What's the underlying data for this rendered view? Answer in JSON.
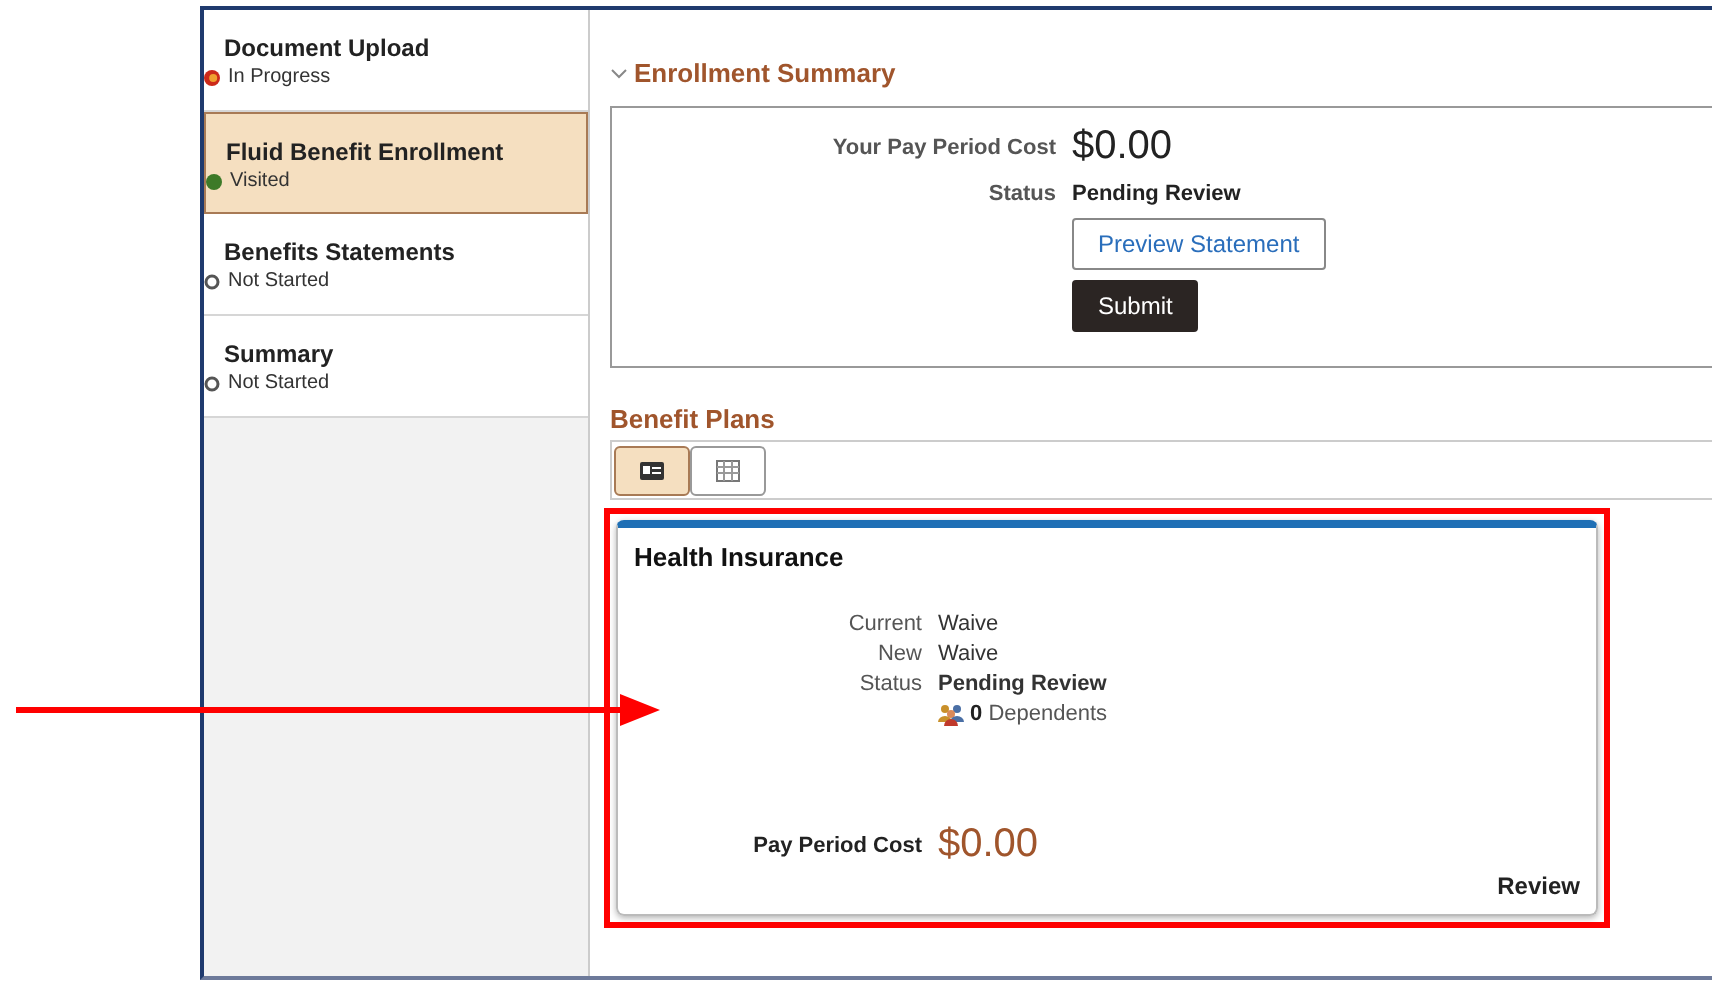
{
  "sidebar": {
    "items": [
      {
        "title": "Document Upload",
        "status": "In Progress",
        "kind": "in_progress",
        "selected": false
      },
      {
        "title": "Fluid Benefit Enrollment",
        "status": "Visited",
        "kind": "visited",
        "selected": true
      },
      {
        "title": "Benefits Statements",
        "status": "Not Started",
        "kind": "not_started",
        "selected": false
      },
      {
        "title": "Summary",
        "status": "Not Started",
        "kind": "not_started",
        "selected": false
      }
    ]
  },
  "enrollment_summary": {
    "heading": "Enrollment Summary",
    "expanded": true,
    "cost_label": "Your Pay Period Cost",
    "cost": "$0.00",
    "status_label": "Status",
    "status": "Pending Review",
    "buttons": [
      {
        "label": "Preview Statement",
        "kind": "secondary"
      },
      {
        "label": "Submit",
        "kind": "primary"
      }
    ]
  },
  "benefit_plans": {
    "heading": "Benefit Plans",
    "views": [
      {
        "kind": "tile",
        "selected": true
      },
      {
        "kind": "grid",
        "selected": false
      }
    ],
    "card": {
      "title": "Health Insurance",
      "highlighted": true,
      "fields": [
        {
          "label": "Current",
          "value": "Waive",
          "kind": "plain"
        },
        {
          "label": "New",
          "value": "Waive",
          "kind": "plain"
        },
        {
          "label": "Status",
          "value": "Pending Review",
          "kind": "bold"
        }
      ],
      "dependents_count": "0",
      "dependents_label": "Dependents",
      "cost_label": "Pay Period Cost",
      "cost": "$0.00",
      "action": "Review"
    }
  }
}
